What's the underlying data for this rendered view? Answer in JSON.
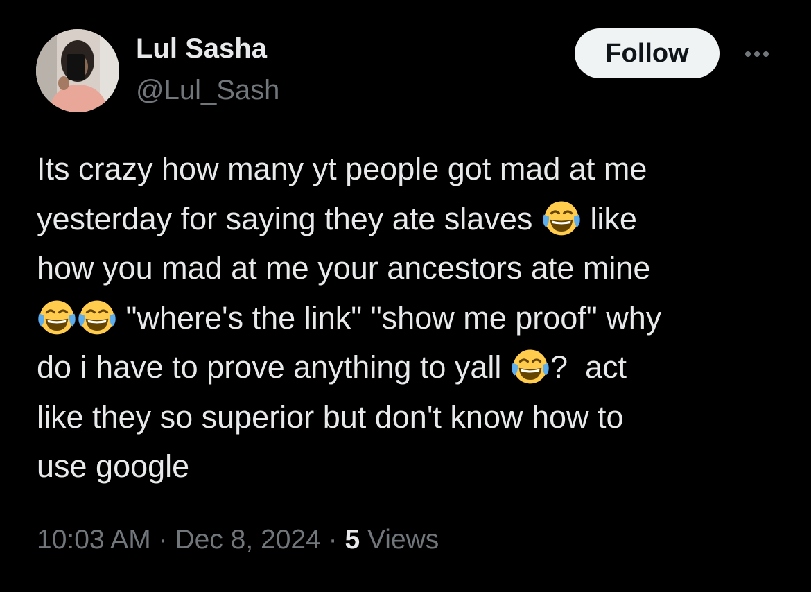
{
  "user": {
    "display_name": "Lul Sasha",
    "handle": "@Lul_Sash",
    "avatar_icon": "profile-photo"
  },
  "actions": {
    "follow_label": "Follow",
    "more_icon": "more-horizontal-icon"
  },
  "tweet": {
    "lines": [
      [
        "Its crazy how many yt people got mad at me"
      ],
      [
        "yesterday for saying they ate slaves ",
        "😂",
        " like"
      ],
      [
        "how you mad at me your ancestors ate mine"
      ],
      [
        "😂",
        "😂",
        " \"where's the link\" \"show me proof\" why"
      ],
      [
        "do i have to prove anything to yall ",
        "😂",
        "?  act"
      ],
      [
        "like they so superior but don't know how to"
      ],
      [
        "use google"
      ]
    ],
    "emoji_name": "face-with-tears-of-joy-icon"
  },
  "meta": {
    "time": "10:03 AM",
    "sep1": " · ",
    "date": "Dec 8, 2024",
    "sep2": " · ",
    "views_count": "5",
    "views_label": " Views"
  },
  "colors": {
    "background": "#000000",
    "primary_text": "#e7e9ea",
    "secondary_text": "#71767b",
    "button_bg": "#eff3f4",
    "button_text": "#0f1419"
  }
}
